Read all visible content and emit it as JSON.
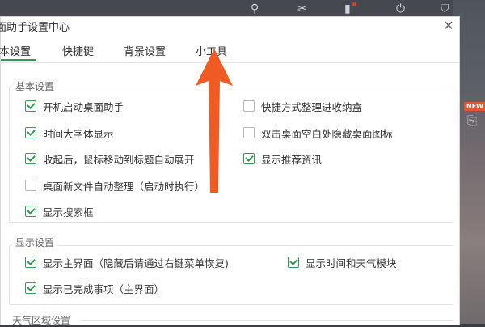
{
  "window": {
    "title": "面助手设置中心",
    "close_glyph": "✕"
  },
  "tabs": [
    {
      "label": "本设置",
      "active": true
    },
    {
      "label": "快捷键",
      "active": false
    },
    {
      "label": "背景设置",
      "active": false
    },
    {
      "label": "小工具",
      "active": false
    }
  ],
  "groups": {
    "basic": {
      "title": "基本设置",
      "left": [
        {
          "label": "开机启动桌面助手",
          "checked": true
        },
        {
          "label": "时间大字体显示",
          "checked": true
        },
        {
          "label": "收起后，鼠标移动到标题自动展开",
          "checked": true
        },
        {
          "label": "桌面新文件自动整理（启动时执行）",
          "checked": false
        },
        {
          "label": "显示搜索框",
          "checked": true
        }
      ],
      "right": [
        {
          "label": "快捷方式整理进收纳盒",
          "checked": false
        },
        {
          "label": "双击桌面空白处隐藏桌面图标",
          "checked": false
        },
        {
          "label": "显示推荐资讯",
          "checked": true
        }
      ]
    },
    "display": {
      "title": "显示设置",
      "items": [
        {
          "label": "显示主界面（隐藏后请通过右键菜单恢复)",
          "checked": true
        },
        {
          "label": "显示时间和天气模块",
          "checked": true
        },
        {
          "label": "显示已完成事项（主界面）",
          "checked": true
        }
      ]
    },
    "weather": {
      "title": "天气区域设置"
    }
  },
  "overlay": {
    "badge": "NEW",
    "accent": "#f05a23"
  },
  "colors": {
    "check_green": "#2f9d4e",
    "arrow_orange": "#f05a23"
  }
}
